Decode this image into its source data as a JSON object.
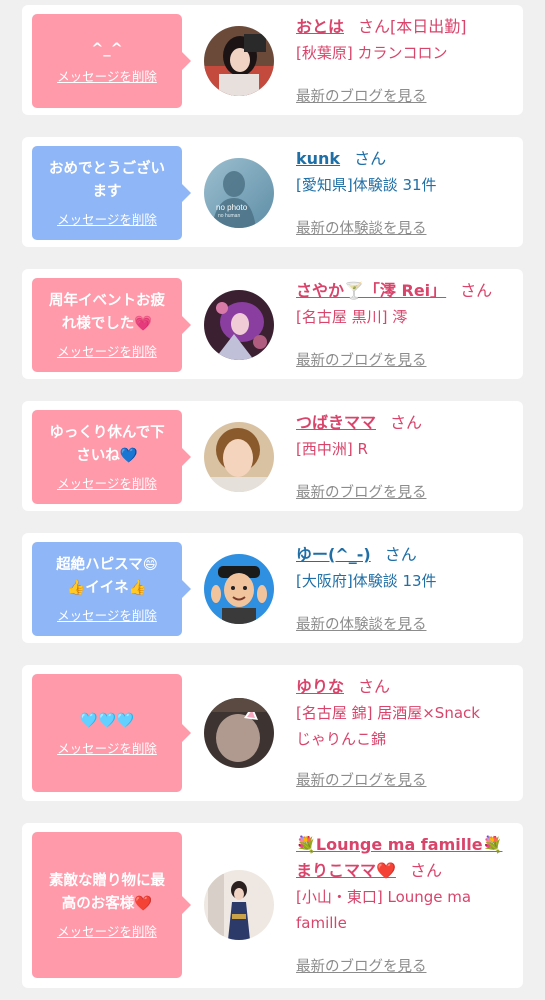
{
  "items": [
    {
      "bubble_color": "pink",
      "message_lines": [
        "^_^"
      ],
      "delete_label": "メッセージを削除",
      "name": "おとは",
      "honorific": "さん",
      "inline_suffix": "[本日出勤]",
      "detail_lines": [
        "[秋葉原] カランコロン"
      ],
      "link_label": "最新のブログを見る",
      "avatar": "photo-girl-dark-hair"
    },
    {
      "bubble_color": "blue",
      "message_lines": [
        "おめでとうござい",
        "ます"
      ],
      "delete_label": "メッセージを削除",
      "name": "kunk",
      "honorific": "さん",
      "inline_suffix": "",
      "detail_lines": [
        "[愛知県]体験談 31件"
      ],
      "link_label": "最新の体験談を見る",
      "avatar": "no-photo-silhouette",
      "avatar_text": [
        "no photo",
        "no human"
      ]
    },
    {
      "bubble_color": "pink",
      "message_lines": [
        "周年イベントお疲",
        "れ様でした💗"
      ],
      "delete_label": "メッセージを削除",
      "name": "さやか🍸「澪 Rei」",
      "honorific": "さん",
      "inline_suffix": "",
      "detail_lines": [
        "[名古屋 黒川] 澪"
      ],
      "link_label": "最新のブログを見る",
      "avatar": "photo-purple-costume"
    },
    {
      "bubble_color": "pink",
      "message_lines": [
        "ゆっくり休んで下",
        "さいね💙"
      ],
      "delete_label": "メッセージを削除",
      "name": "つばきママ",
      "honorific": "さん",
      "inline_suffix": "",
      "detail_lines": [
        "[西中洲] R"
      ],
      "link_label": "最新のブログを見る",
      "avatar": "photo-woman-selfie"
    },
    {
      "bubble_color": "blue",
      "message_lines": [
        "超絶ハピスマ😄",
        "👍イイネ👍"
      ],
      "delete_label": "メッセージを削除",
      "name": "ゆー(^_-)",
      "honorific": "さん",
      "inline_suffix": "",
      "detail_lines": [
        "[大阪府]体験談 13件"
      ],
      "link_label": "最新の体験談を見る",
      "avatar": "memoji-man-peace"
    },
    {
      "bubble_color": "pink",
      "message_lines": [
        "🩵🩵🩵"
      ],
      "delete_label": "メッセージを削除",
      "name": "ゆりな",
      "honorific": "さん",
      "inline_suffix": "",
      "detail_lines": [
        "[名古屋 錦] 居酒屋×Snack",
        "じゃりんこ錦"
      ],
      "link_label": "最新のブログを見る",
      "avatar": "photo-cat-ear-filter"
    },
    {
      "bubble_color": "pink",
      "message_lines": [
        "素敵な贈り物に最",
        "高のお客様❤️"
      ],
      "delete_label": "メッセージを削除",
      "name_line1": "💐Lounge ma famille💐",
      "name": "まりこママ❤️",
      "honorific": "さん",
      "inline_suffix": "",
      "detail_lines": [
        "[小山・東口] Lounge ma",
        "famille"
      ],
      "link_label": "最新のブログを見る",
      "avatar": "photo-woman-kimono"
    }
  ],
  "colors": {
    "pink_bubble": "#ff9aaa",
    "blue_bubble": "#8fb6f6",
    "pink_text": "#d9446b",
    "blue_text": "#1f6fa6",
    "link_gray": "#8c8c8c",
    "background": "#f0f0f0"
  }
}
